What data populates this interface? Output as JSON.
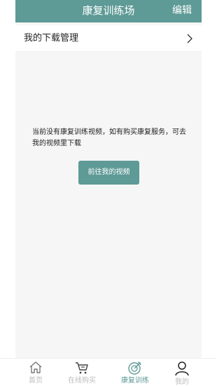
{
  "header": {
    "title": "康复训练场",
    "edit_label": "编辑"
  },
  "downloads": {
    "label": "我的下载管理"
  },
  "empty_state": {
    "message": "当前没有康复训练视频，如有购买康复服务，可去我的视频里下载",
    "button_label": "前往我的视频"
  },
  "tabbar": {
    "items": [
      {
        "label": "首页",
        "icon": "home-icon"
      },
      {
        "label": "在线购买",
        "icon": "cart-icon"
      },
      {
        "label": "康复训练",
        "icon": "target-icon"
      },
      {
        "label": "我的",
        "icon": "user-icon"
      }
    ],
    "active_color": "#5e9a96",
    "inactive_color": "#bcbcbc"
  },
  "colors": {
    "accent": "#5e9a96"
  }
}
